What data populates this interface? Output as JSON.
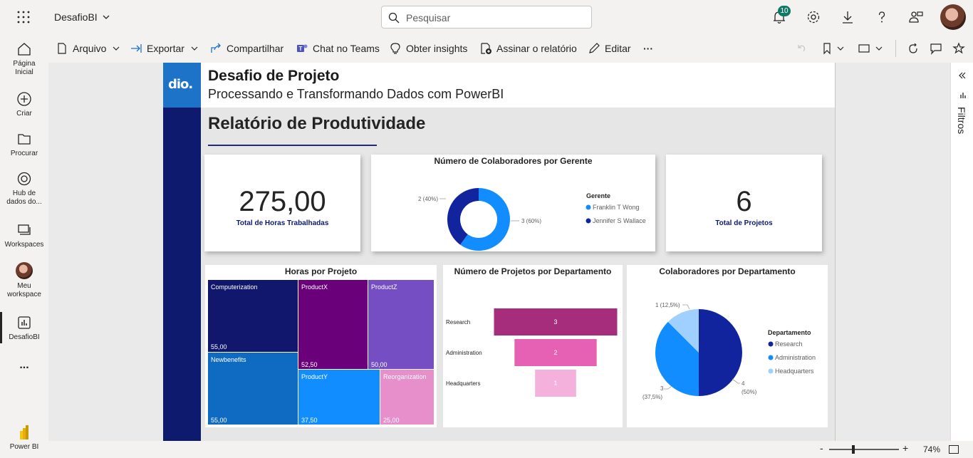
{
  "topbar": {
    "app_name": "DesafioBI",
    "search_placeholder": "Pesquisar",
    "notifications_count": "10"
  },
  "leftnav": {
    "items": [
      {
        "label_line1": "Página",
        "label_line2": "Inicial",
        "icon": "home-icon"
      },
      {
        "label_line1": "Criar",
        "label_line2": "",
        "icon": "plus-circle-icon"
      },
      {
        "label_line1": "Procurar",
        "label_line2": "",
        "icon": "folder-icon"
      },
      {
        "label_line1": "Hub de",
        "label_line2": "dados do...",
        "icon": "data-hub-icon"
      },
      {
        "label_line1": "Workspaces",
        "label_line2": "",
        "icon": "workspaces-icon"
      },
      {
        "label_line1": "Meu",
        "label_line2": "workspace",
        "icon": "avatar"
      },
      {
        "label_line1": "DesafioBI",
        "label_line2": "",
        "icon": "report-icon"
      },
      {
        "label_line1": "...",
        "label_line2": "",
        "icon": "more-icon"
      },
      {
        "label_line1": "Power BI",
        "label_line2": "",
        "icon": "powerbi-logo"
      }
    ]
  },
  "actionbar": {
    "file": "Arquivo",
    "export": "Exportar",
    "share": "Compartilhar",
    "teams": "Chat no Teams",
    "insights": "Obter insights",
    "subscribe": "Assinar o relatório",
    "edit": "Editar",
    "more": "···"
  },
  "filters": {
    "label": "Filtros"
  },
  "statusbar": {
    "zoom_minus": "-",
    "zoom_plus": "+",
    "zoom": "74%",
    "zoom_fraction": 0.37
  },
  "report": {
    "logo_text": "dio.",
    "title": "Desafio de Projeto",
    "subtitle": "Processando e Transformando Dados com PowerBI",
    "heading": "Relatório de Produtividade",
    "colors": {
      "sidebar": "#0e1a6e",
      "logo_bg": "#1c73c8"
    },
    "kpi_hours": {
      "value": "275,00",
      "label": "Total de Horas Trabalhadas"
    },
    "kpi_projects": {
      "value": "6",
      "label": "Total de Projetos"
    },
    "donut": {
      "title": "Número de Colaboradores por Gerente",
      "legend_title": "Gerente",
      "label_left": "2 (40%)",
      "label_right": "3 (60%)",
      "slices": [
        {
          "name": "Franklin T Wong",
          "value": 3,
          "color": "#118dff"
        },
        {
          "name": "Jennifer S Wallace",
          "value": 2,
          "color": "#12239e"
        }
      ]
    },
    "treemap": {
      "title": "Horas por Projeto",
      "items": [
        {
          "name": "Computerization",
          "value": "55,00",
          "color": "#12176e"
        },
        {
          "name": "Newbenefits",
          "value": "55,00",
          "color": "#0f6ac2"
        },
        {
          "name": "ProductX",
          "value": "52,50",
          "color": "#6b007b"
        },
        {
          "name": "ProductZ",
          "value": "50,00",
          "color": "#744ec2"
        },
        {
          "name": "ProductY",
          "value": "37,50",
          "color": "#118dff"
        },
        {
          "name": "Reorganization",
          "value": "25,00",
          "color": "#e68fcb"
        }
      ]
    },
    "funnel": {
      "title": "Número de Projetos por Departamento",
      "items": [
        {
          "name": "Research",
          "value": 3,
          "color": "#a62c7c"
        },
        {
          "name": "Administration",
          "value": 2,
          "color": "#e660b4"
        },
        {
          "name": "Headquarters",
          "value": 1,
          "color": "#f3b1dc"
        }
      ]
    },
    "pie": {
      "title": "Colaboradores por Departamento",
      "legend_title": "Departamento",
      "label_top": "1 (12,5%)",
      "label_bottom_left_1": "3",
      "label_bottom_left_2": "(37,5%)",
      "label_right_1": "4",
      "label_right_2": "(50%)",
      "slices": [
        {
          "name": "Research",
          "value": 4,
          "color": "#12239e"
        },
        {
          "name": "Administration",
          "value": 3,
          "color": "#118dff"
        },
        {
          "name": "Headquarters",
          "value": 1,
          "color": "#9fd0ff"
        }
      ]
    }
  }
}
